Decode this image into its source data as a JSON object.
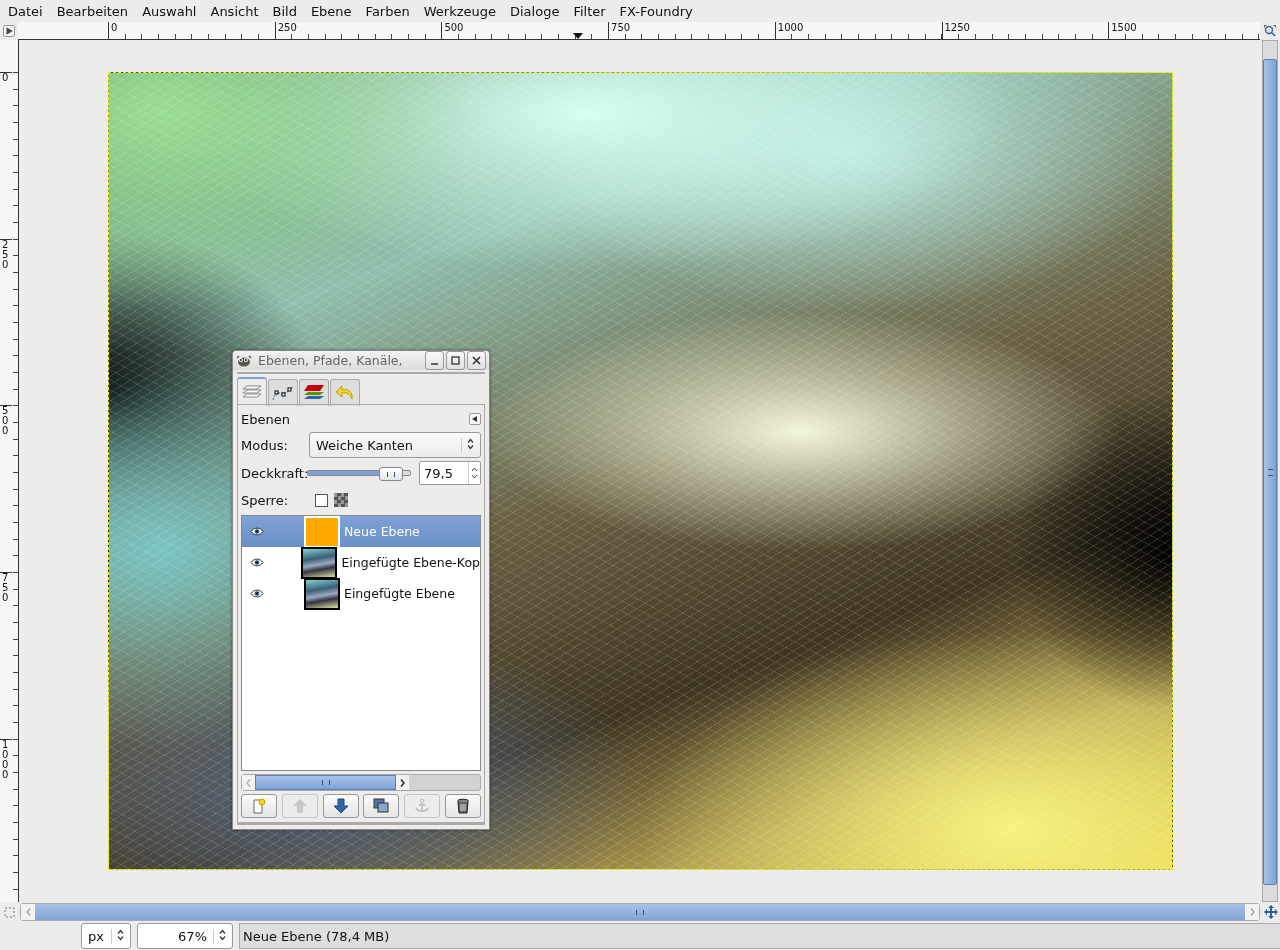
{
  "menu": [
    "Datei",
    "Bearbeiten",
    "Auswahl",
    "Ansicht",
    "Bild",
    "Ebene",
    "Farben",
    "Werkzeuge",
    "Dialoge",
    "Filter",
    "FX-Foundry"
  ],
  "rulers": {
    "horizontal": [
      "0",
      "250",
      "500",
      "750",
      "1000",
      "1250",
      "1500"
    ],
    "vertical": [
      "0",
      "250",
      "500",
      "750",
      "1000"
    ]
  },
  "dialog": {
    "title": "Ebenen, Pfade, Kanäle,",
    "tabs": [
      {
        "kind": "layers",
        "selected": true
      },
      {
        "kind": "paths",
        "selected": false
      },
      {
        "kind": "channels",
        "selected": false
      },
      {
        "kind": "undo",
        "selected": false
      }
    ],
    "panel_title": "Ebenen",
    "mode": {
      "label": "Modus:",
      "value": "Weiche Kanten"
    },
    "opacity": {
      "label": "Deckkraft:",
      "level": 0.795,
      "value": "79,5"
    },
    "lock": {
      "label": "Sperre:",
      "checked": false
    },
    "layers": [
      {
        "name": "Neue Ebene",
        "visible": true,
        "selected": true,
        "kind": "solid",
        "color": "#ffaa00"
      },
      {
        "name": "Eingefügte Ebene-Kop",
        "visible": true,
        "selected": false,
        "kind": "image"
      },
      {
        "name": "Eingefügte Ebene",
        "visible": true,
        "selected": false,
        "kind": "image"
      }
    ],
    "buttons": [
      {
        "kind": "new",
        "disabled": false
      },
      {
        "kind": "raise",
        "disabled": true
      },
      {
        "kind": "lower",
        "disabled": false
      },
      {
        "kind": "duplicate",
        "disabled": false
      },
      {
        "kind": "anchor",
        "disabled": true
      },
      {
        "kind": "delete",
        "disabled": false
      }
    ]
  },
  "status_bar": {
    "unit": "px",
    "zoom": "67%",
    "message": "Neue Ebene (78,4 MB)"
  }
}
